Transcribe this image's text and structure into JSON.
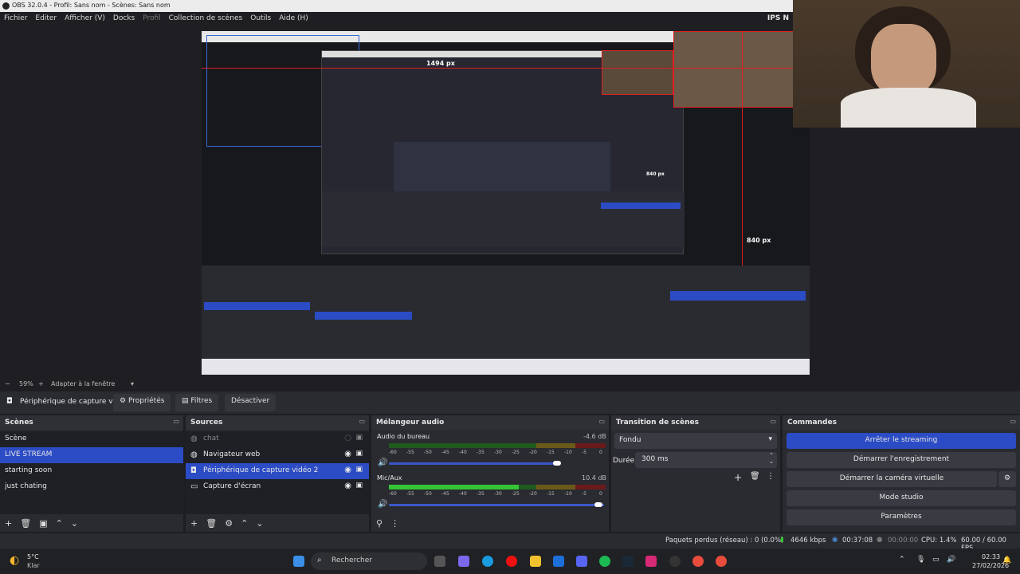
{
  "window": {
    "title": "OBS 32.0.4 - Profil: Sans nom - Scènes: Sans nom"
  },
  "menu": {
    "items": [
      "Fichier",
      "Editer",
      "Afficher (V)",
      "Docks",
      "Profil",
      "Collection de scènes",
      "Outils",
      "Aide (H)"
    ],
    "right_text": "IPS N"
  },
  "preview": {
    "annotation_840": "840 px",
    "annotation_840b": "840 px",
    "annotation_1494": "1494 px"
  },
  "zoom": {
    "value": "59%",
    "fit_label": "Adapter à la fenêtre"
  },
  "toolbar": {
    "source_name": "Périphérique de capture vic",
    "properties": "Propriétés",
    "filters": "Filtres",
    "deactivate": "Désactiver"
  },
  "scenes": {
    "title": "Scènes",
    "items": [
      "Scène",
      "LIVE STREAM",
      "starting soon",
      "just chating"
    ],
    "selected_index": 1
  },
  "sources": {
    "title": "Sources",
    "items": [
      {
        "name": "chat",
        "icon": "globe-icon",
        "visible": false
      },
      {
        "name": "Navigateur web",
        "icon": "globe-icon",
        "visible": true
      },
      {
        "name": "Périphérique de capture vidéo 2",
        "icon": "camera-icon",
        "visible": true
      },
      {
        "name": "Capture d'écran",
        "icon": "monitor-icon",
        "visible": true
      }
    ],
    "selected_index": 2
  },
  "mixer": {
    "title": "Mélangeur audio",
    "channels": [
      {
        "name": "Audio du bureau",
        "db": "-4.6 dB",
        "level": 0.0
      },
      {
        "name": "Mic/Aux",
        "db": "10.4 dB",
        "level": 0.6
      }
    ],
    "scale": [
      "-60",
      "-55",
      "-50",
      "-45",
      "-40",
      "-35",
      "-30",
      "-25",
      "-20",
      "-15",
      "-10",
      "-5",
      "0"
    ]
  },
  "transition": {
    "title": "Transition de scènes",
    "type": "Fondu",
    "duration_label": "Durée",
    "duration_value": "300 ms"
  },
  "commands": {
    "title": "Commandes",
    "buttons": [
      "Arrêter le streaming",
      "Démarrer l'enregistrement",
      "Démarrer la caméra virtuelle",
      "Mode studio",
      "Paramètres"
    ]
  },
  "status": {
    "dropped": "Paquets perdus (réseau) : 0 (0.0%)",
    "bitrate": "4646 kbps",
    "stream_time": "00:37:08",
    "rec_time": "00:00:00",
    "cpu": "CPU: 1.4%",
    "fps": "60.00 / 60.00 FPS"
  },
  "taskbar": {
    "weather_temp": "5°C",
    "weather_desc": "Klar",
    "search": "Rechercher",
    "time": "02:33",
    "date": "27/02/2026"
  },
  "colors": {
    "accent": "#2b4cc4",
    "bg": "#1f1f23",
    "panel": "#2a2b30"
  }
}
